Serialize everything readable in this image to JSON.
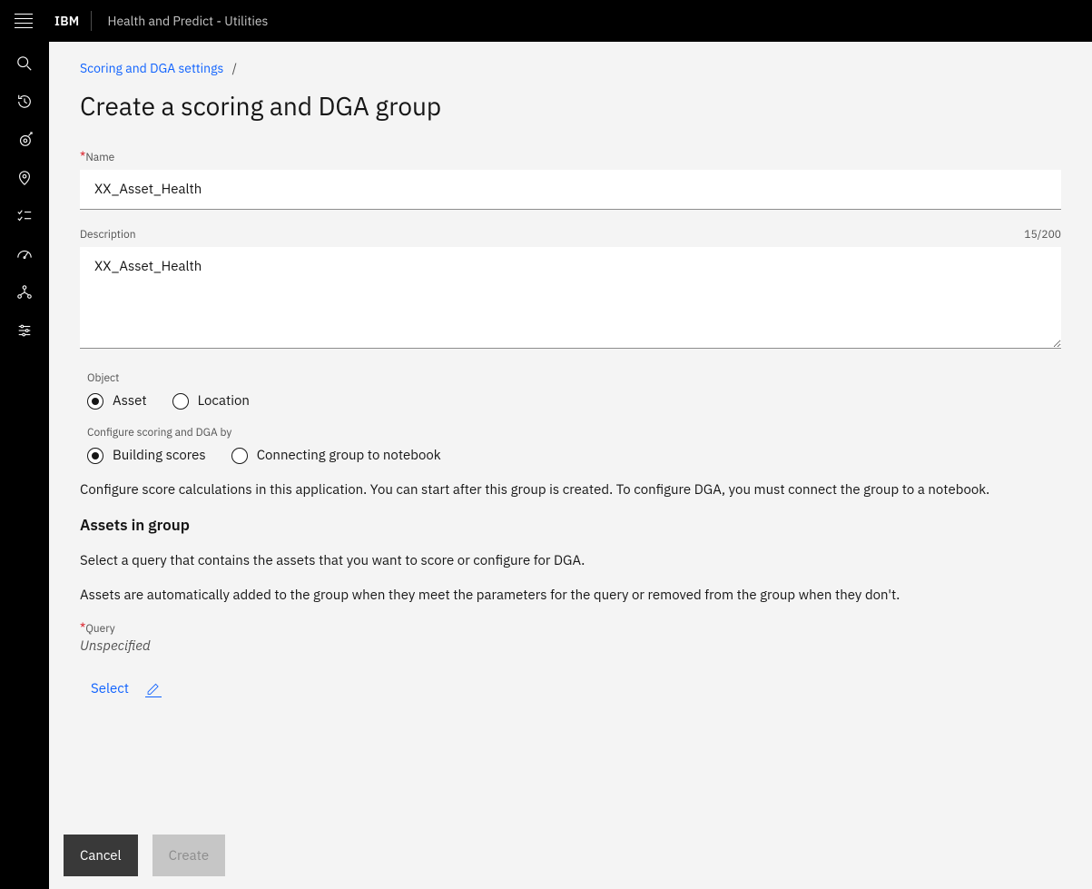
{
  "header": {
    "brand": "IBM",
    "app_title": "Health and Predict - Utilities"
  },
  "sidebar": {
    "icons": [
      "search-icon",
      "history-icon",
      "target-icon",
      "location-pin-icon",
      "checklist-icon",
      "gauge-icon",
      "connect-icon",
      "sliders-icon"
    ]
  },
  "breadcrumb": {
    "link_text": "Scoring and DGA settings",
    "separator": "/"
  },
  "page": {
    "title": "Create a scoring and DGA group"
  },
  "form": {
    "name_label": "Name",
    "name_value": "XX_Asset_Health",
    "description_label": "Description",
    "description_value": "XX_Asset_Health",
    "description_counter": "15/200",
    "object_label": "Object",
    "object_options": {
      "asset": "Asset",
      "location": "Location"
    },
    "object_selected": "asset",
    "configure_label": "Configure scoring and DGA by",
    "configure_options": {
      "building": "Building scores",
      "notebook": "Connecting group to notebook"
    },
    "configure_selected": "building",
    "helper_text": "Configure score calculations in this application. You can start after this group is created. To configure DGA, you must connect the group to a notebook.",
    "assets_heading": "Assets in group",
    "assets_text1": "Select a query that contains the assets that you want to score or configure for DGA.",
    "assets_text2": "Assets are automatically added to the group when they meet the parameters for the query or removed from the group when they don't.",
    "query_label": "Query",
    "query_value": "Unspecified",
    "select_label": "Select"
  },
  "footer": {
    "cancel": "Cancel",
    "create": "Create"
  }
}
